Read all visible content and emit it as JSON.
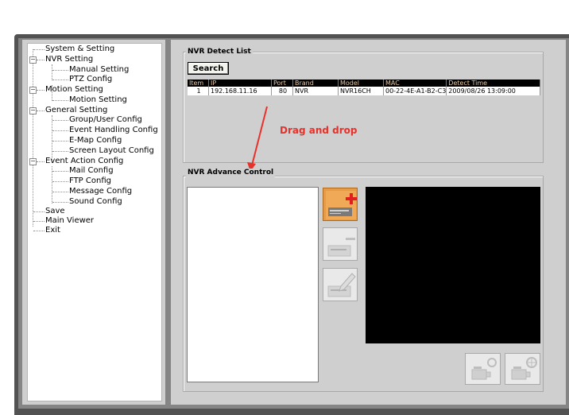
{
  "tree": {
    "items": [
      {
        "label": "System & Setting"
      },
      {
        "label": "NVR  Setting"
      },
      {
        "label": "Manual Setting"
      },
      {
        "label": "PTZ Config"
      },
      {
        "label": "Motion Setting"
      },
      {
        "label": "Motion Setting"
      },
      {
        "label": "General Setting"
      },
      {
        "label": "Group/User Config"
      },
      {
        "label": "Event Handling Config"
      },
      {
        "label": "E-Map Config"
      },
      {
        "label": "Screen Layout Config"
      },
      {
        "label": "Event Action Config"
      },
      {
        "label": "Mail Config"
      },
      {
        "label": "FTP Config"
      },
      {
        "label": "Message Config"
      },
      {
        "label": "Sound Config"
      },
      {
        "label": "Save"
      },
      {
        "label": "Main Viewer"
      },
      {
        "label": "Exit"
      }
    ],
    "expander_symbol": "−"
  },
  "detect": {
    "title": "NVR  Detect List",
    "search_label": "Search",
    "columns": [
      "Item",
      "IP",
      "Port",
      "Brand",
      "Model",
      "MAC",
      "Detect Time"
    ],
    "rows": [
      [
        "1",
        "192.168.11.16",
        "80",
        "NVR",
        "NVR16CH",
        "00-22-4E-A1-B2-C3",
        "2009/08/26 13:09:00"
      ]
    ]
  },
  "annotation": {
    "drag_label": "Drag and drop"
  },
  "advance": {
    "title": "NVR  Advance Control"
  },
  "colors": {
    "header_text": "#e6c7a0",
    "annotation": "#e8312a",
    "active_button": "#e89a44"
  },
  "icons": {
    "add": "add-nvr-icon",
    "remove": "remove-nvr-icon",
    "edit": "edit-nvr-icon",
    "refresh": "camera-refresh-icon",
    "web": "camera-web-icon"
  }
}
